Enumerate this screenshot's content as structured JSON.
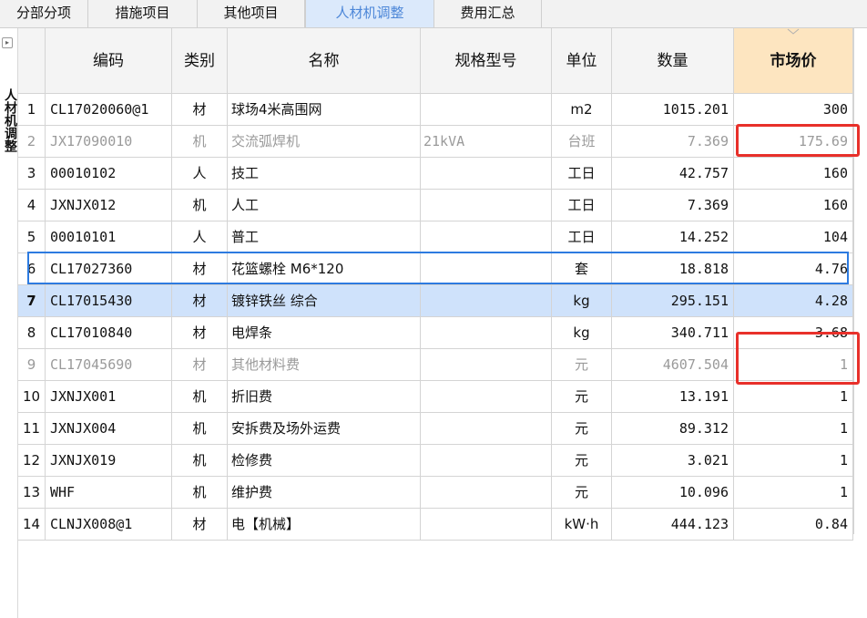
{
  "tabs": [
    {
      "label": "分部分项",
      "active": false
    },
    {
      "label": "措施项目",
      "active": false
    },
    {
      "label": "其他项目",
      "active": false
    },
    {
      "label": "人材机调整",
      "active": true
    },
    {
      "label": "费用汇总",
      "active": false
    }
  ],
  "side_panel": {
    "label": "人材机调整",
    "toggle_icon": "chevron-right-icon"
  },
  "table": {
    "headers": {
      "no": "",
      "code": "编码",
      "type": "类别",
      "name": "名称",
      "spec": "规格型号",
      "unit": "单位",
      "qty": "数量",
      "price": "市场价"
    },
    "rows": [
      {
        "no": "1",
        "code": "CL17020060@1",
        "type": "材",
        "name": "球场4米高围网",
        "spec": "",
        "unit": "m2",
        "qty": "1015.201",
        "price": "300",
        "state": "normal"
      },
      {
        "no": "2",
        "code": "JX17090010",
        "type": "机",
        "name": "交流弧焊机",
        "spec": "21kVA",
        "unit": "台班",
        "qty": "7.369",
        "price": "175.69",
        "state": "gray"
      },
      {
        "no": "3",
        "code": "00010102",
        "type": "人",
        "name": "技工",
        "spec": "",
        "unit": "工日",
        "qty": "42.757",
        "price": "160",
        "state": "normal"
      },
      {
        "no": "4",
        "code": "JXNJX012",
        "type": "机",
        "name": "人工",
        "spec": "",
        "unit": "工日",
        "qty": "7.369",
        "price": "160",
        "state": "normal"
      },
      {
        "no": "5",
        "code": "00010101",
        "type": "人",
        "name": "普工",
        "spec": "",
        "unit": "工日",
        "qty": "14.252",
        "price": "104",
        "state": "normal"
      },
      {
        "no": "6",
        "code": "CL17027360",
        "type": "材",
        "name": "花篮螺栓 M6*120",
        "spec": "",
        "unit": "套",
        "qty": "18.818",
        "price": "4.76",
        "state": "normal"
      },
      {
        "no": "7",
        "code": "CL17015430",
        "type": "材",
        "name": "镀锌铁丝 综合",
        "spec": "",
        "unit": "kg",
        "qty": "295.151",
        "price": "4.28",
        "state": "selected"
      },
      {
        "no": "8",
        "code": "CL17010840",
        "type": "材",
        "name": "电焊条",
        "spec": "",
        "unit": "kg",
        "qty": "340.711",
        "price": "3.68",
        "state": "normal"
      },
      {
        "no": "9",
        "code": "CL17045690",
        "type": "材",
        "name": "其他材料费",
        "spec": "",
        "unit": "元",
        "qty": "4607.504",
        "price": "1",
        "state": "gray"
      },
      {
        "no": "10",
        "code": "JXNJX001",
        "type": "机",
        "name": "折旧费",
        "spec": "",
        "unit": "元",
        "qty": "13.191",
        "price": "1",
        "state": "normal"
      },
      {
        "no": "11",
        "code": "JXNJX004",
        "type": "机",
        "name": "安拆费及场外运费",
        "spec": "",
        "unit": "元",
        "qty": "89.312",
        "price": "1",
        "state": "normal"
      },
      {
        "no": "12",
        "code": "JXNJX019",
        "type": "机",
        "name": "检修费",
        "spec": "",
        "unit": "元",
        "qty": "3.021",
        "price": "1",
        "state": "normal"
      },
      {
        "no": "13",
        "code": "WHF",
        "type": "机",
        "name": "维护费",
        "spec": "",
        "unit": "元",
        "qty": "10.096",
        "price": "1",
        "state": "normal"
      },
      {
        "no": "14",
        "code": "CLNJX008@1",
        "type": "材",
        "name": "电【机械】",
        "spec": "",
        "unit": "kW·h",
        "qty": "444.123",
        "price": "0.84",
        "state": "normal"
      }
    ]
  },
  "colors": {
    "active_tab_bg": "#dbe9fb",
    "active_tab_text": "#4d87d8",
    "market_price_header_bg": "#fde5c0",
    "selection_bg": "#cfe2fb",
    "selection_border": "#2d7be0",
    "highlight_box": "#e8302a",
    "disabled_text": "#9a9a9a"
  }
}
